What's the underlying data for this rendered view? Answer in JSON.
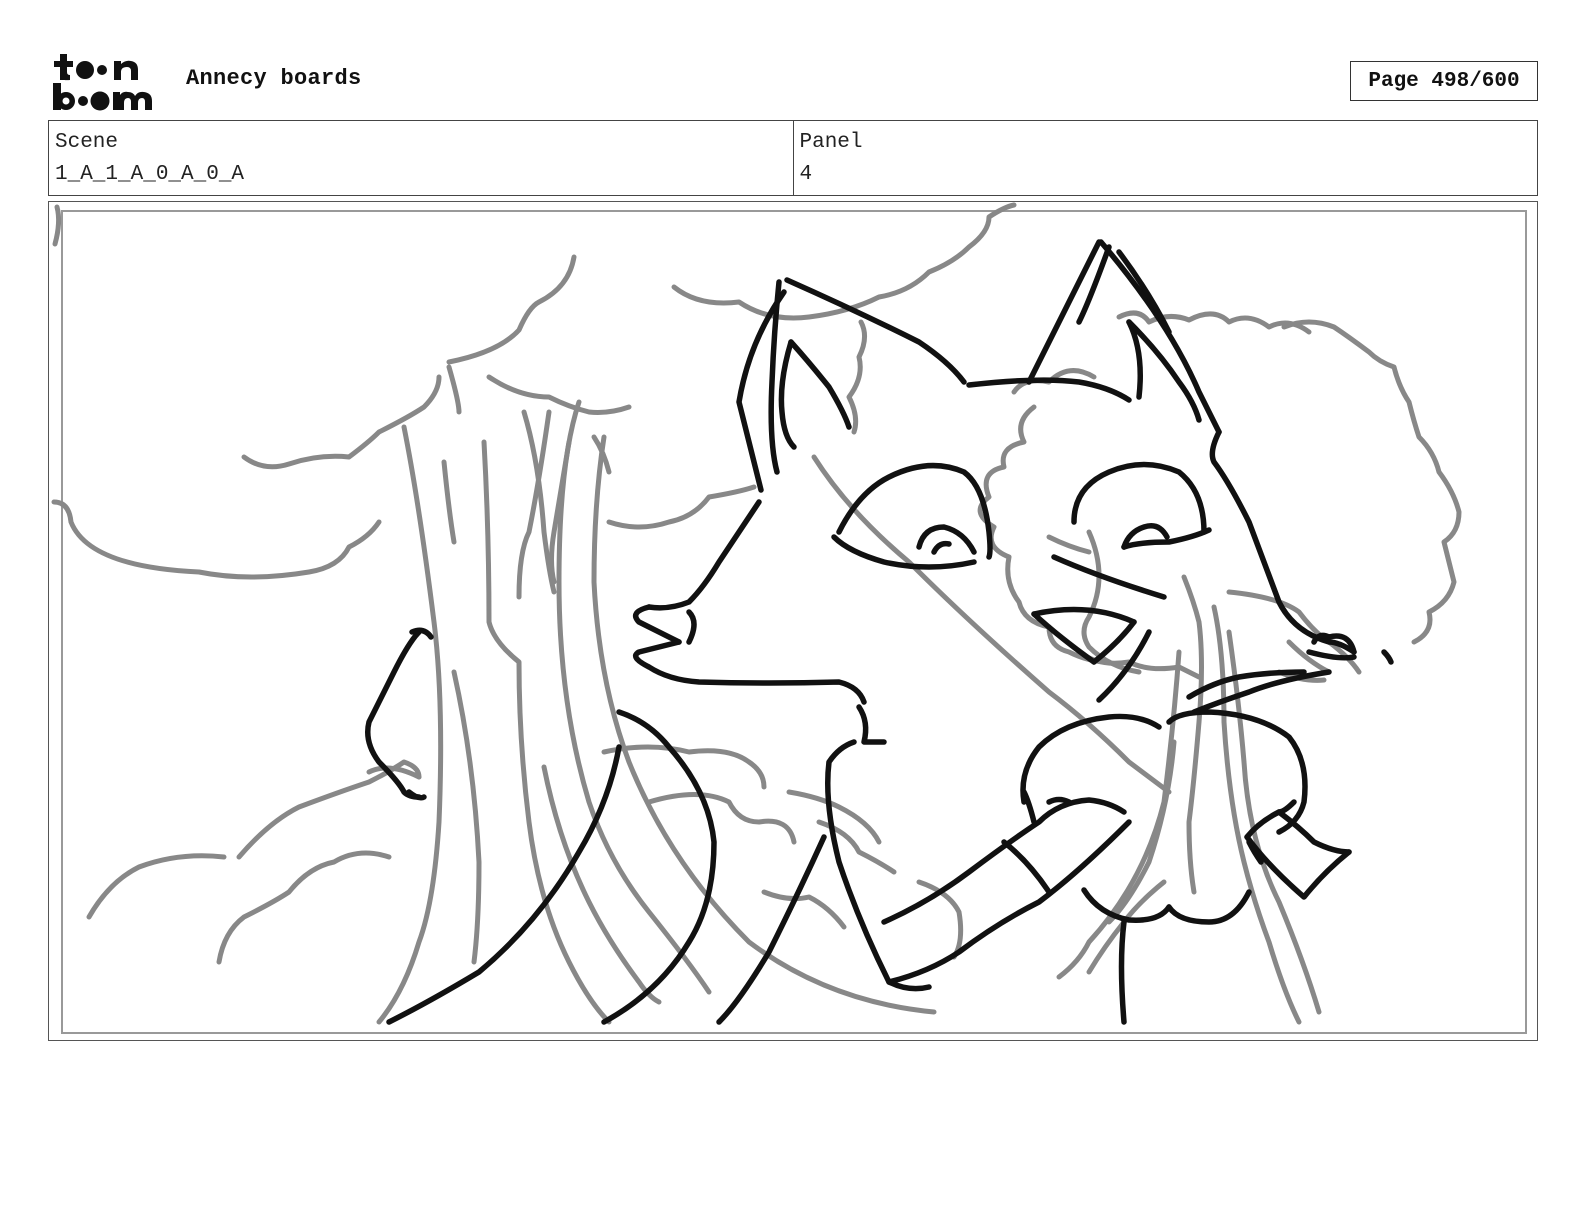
{
  "header": {
    "logo": {
      "icon": "toonboom-logo",
      "line1": "toon",
      "line2": "boom"
    },
    "app_title": "Annecy boards",
    "page_indicator": "Page 498/600"
  },
  "info": {
    "scene_label": "Scene",
    "scene_value": "1_A_1_A_0_A_0_A",
    "panel_label": "Panel",
    "panel_value": "4"
  },
  "panel_image": {
    "icon": "storyboard-sketch-image",
    "colors": {
      "ink": "#111111",
      "rough": "#888888"
    }
  }
}
